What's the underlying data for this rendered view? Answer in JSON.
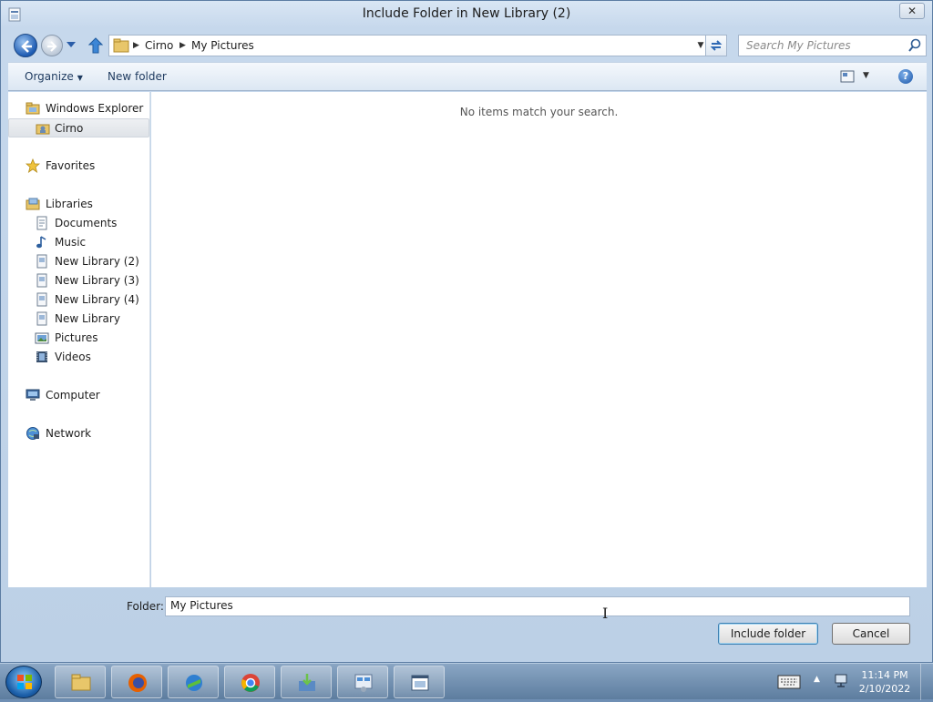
{
  "window": {
    "title": "Include Folder in New Library (2)",
    "close_label": "✕"
  },
  "address": {
    "crumbs": [
      "Cirno",
      "My Pictures"
    ]
  },
  "search": {
    "placeholder": "Search My Pictures"
  },
  "toolbar": {
    "organize_label": "Organize",
    "new_folder_label": "New folder",
    "help_label": "?"
  },
  "sidebar": {
    "items": [
      {
        "label": "Windows Explorer",
        "icon": "explorer-icon"
      },
      {
        "label": "Cirno",
        "icon": "user-folder-icon",
        "selected": true
      },
      {
        "label": "Favorites",
        "icon": "star-icon"
      },
      {
        "label": "Libraries",
        "icon": "libraries-icon"
      },
      {
        "label": "Documents",
        "icon": "documents-icon"
      },
      {
        "label": "Music",
        "icon": "music-icon"
      },
      {
        "label": "New Library (2)",
        "icon": "library-icon"
      },
      {
        "label": "New Library (3)",
        "icon": "library-icon"
      },
      {
        "label": "New Library (4)",
        "icon": "library-icon"
      },
      {
        "label": "New Library",
        "icon": "library-icon"
      },
      {
        "label": "Pictures",
        "icon": "pictures-icon"
      },
      {
        "label": "Videos",
        "icon": "videos-icon"
      },
      {
        "label": "Computer",
        "icon": "computer-icon"
      },
      {
        "label": "Network",
        "icon": "network-icon"
      }
    ]
  },
  "main": {
    "empty_message": "No items match your search."
  },
  "footer": {
    "folder_label": "Folder:",
    "folder_value": "My Pictures",
    "include_button": "Include folder",
    "cancel_button": "Cancel"
  },
  "taskbar": {
    "apps": [
      "explorer-icon",
      "firefox-icon",
      "download-manager-icon",
      "chrome-icon",
      "installer-icon",
      "control-panel-icon",
      "window-app-icon"
    ],
    "time": "11:14 PM",
    "date": "2/10/2022"
  }
}
